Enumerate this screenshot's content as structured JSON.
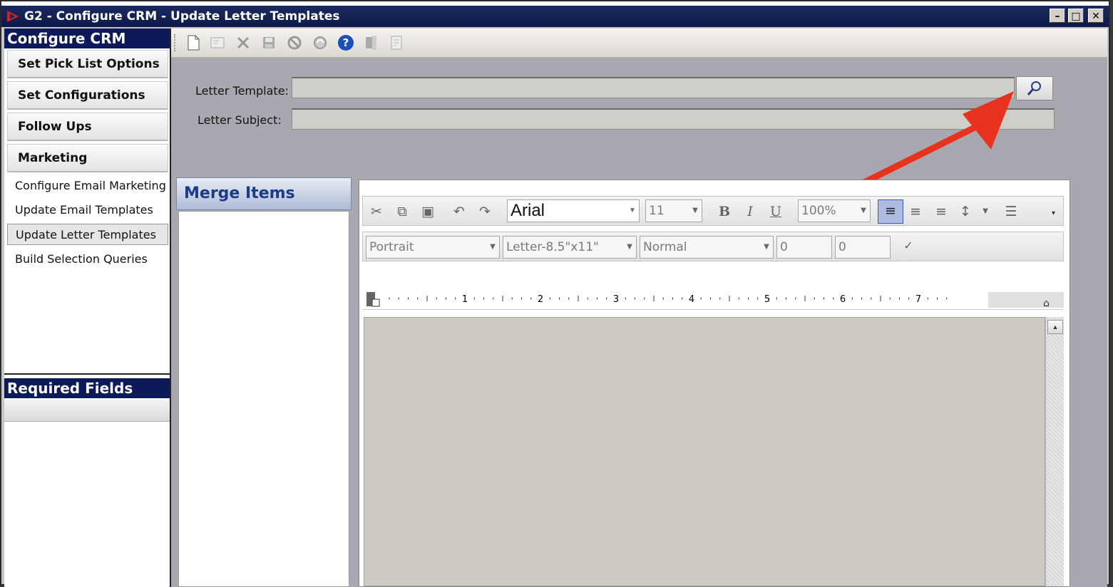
{
  "window": {
    "title": "G2 - Configure CRM - Update Letter Templates",
    "minimize": "–",
    "maximize": "□",
    "close": "✕"
  },
  "sidebar": {
    "header": "Configure CRM",
    "sections": [
      {
        "label": "Set Pick List Options"
      },
      {
        "label": "Set Configurations"
      },
      {
        "label": "Follow Ups"
      },
      {
        "label": "Marketing"
      }
    ],
    "items": [
      {
        "label": "Configure Email Marketing"
      },
      {
        "label": "Update Email Templates"
      },
      {
        "label": "Update Letter Templates",
        "selected": true
      },
      {
        "label": "Build Selection Queries"
      }
    ],
    "required_fields_header": "Required Fields"
  },
  "form": {
    "letter_template_label": "Letter Template:",
    "letter_template_value": "",
    "letter_subject_label": "Letter Subject:",
    "letter_subject_value": ""
  },
  "merge": {
    "header": "Merge Items"
  },
  "editor": {
    "font": "Arial",
    "font_size": "11",
    "zoom": "100%",
    "orientation": "Portrait",
    "paper": "Letter-8.5\"x11\"",
    "style": "Normal",
    "spacing_before": "0",
    "spacing_after": "0",
    "bold": "B",
    "italic": "I",
    "underline": "U",
    "ruler_numbers": [
      "1",
      "2",
      "3",
      "4",
      "5",
      "6",
      "7"
    ]
  },
  "colors": {
    "title_bar": "#0d1a4a",
    "annotation_arrow": "#e8321e"
  }
}
